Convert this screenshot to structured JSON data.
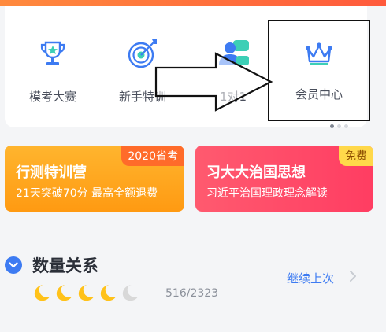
{
  "nav": {
    "items": [
      {
        "label": "模考大赛",
        "icon": "trophy-icon"
      },
      {
        "label": "新手特训",
        "icon": "target-icon"
      },
      {
        "label": "1对1",
        "icon": "tutor-chat-icon"
      },
      {
        "label": "会员中心",
        "icon": "crown-icon"
      }
    ],
    "pages": 3,
    "active_page": 1
  },
  "promos": [
    {
      "title": "行测特训营",
      "subtitle": "21天突破70分 最高全额退费",
      "tag": "2020省考"
    },
    {
      "title": "习大大治国思想",
      "subtitle": "习近平治国理政理念解读",
      "tag": "免费"
    }
  ],
  "section": {
    "title": "数量关系",
    "continue_label": "继续上次",
    "progress": "516/2323",
    "moons_total": 5,
    "moons_filled": 4
  },
  "colors": {
    "accent": "#3d7bf2",
    "orange_banner": "#ffa320",
    "pink_banner": "#ff4a68",
    "moon_filled": "#ffc21a",
    "moon_empty": "#d8d8d8"
  }
}
